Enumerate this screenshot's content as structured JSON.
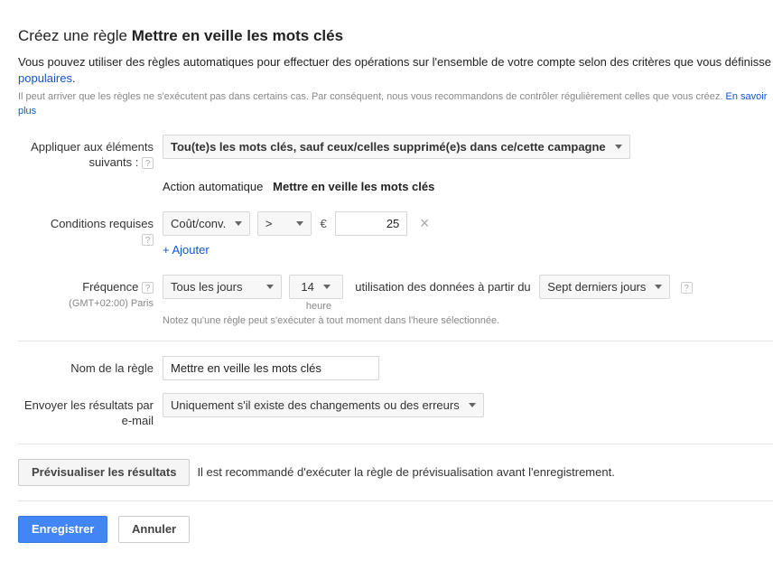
{
  "title_prefix": "Créez une règle",
  "title_bold": "Mettre en veille les mots clés",
  "intro_text": "Vous pouvez utiliser des règles automatiques pour effectuer des opérations sur l'ensemble de votre compte selon des critères que vous définisse",
  "intro_link": "populaires",
  "sub_text": "Il peut arriver que les règles ne s'exécutent pas dans certains cas. Par conséquent, nous vous recommandons de contrôler régulièrement celles que vous créez.",
  "sub_link": "En savoir plus",
  "labels": {
    "apply_to": "Appliquer aux éléments suivants :",
    "conditions": "Conditions requises",
    "frequency": "Fréquence",
    "rule_name": "Nom de la règle",
    "email_results": "Envoyer les résultats par e-mail"
  },
  "apply_to": {
    "selected": "Tou(te)s les mots clés, sauf ceux/celles supprimé(e)s dans ce/cette campagne"
  },
  "auto_action": {
    "label": "Action automatique",
    "value": "Mettre en veille les mots clés"
  },
  "condition": {
    "metric": "Coût/conv.",
    "operator": ">",
    "currency": "€",
    "value": "25",
    "add_label": "+ Ajouter"
  },
  "frequency": {
    "tz": "(GMT+02:00) Paris",
    "every": "Tous les jours",
    "hour": "14",
    "hour_label": "heure",
    "using_label": "utilisation des données à partir du",
    "range": "Sept derniers jours",
    "note": "Notez qu'une règle peut s'exécuter à tout moment dans l'heure sélectionnée."
  },
  "rule_name_value": "Mettre en veille les mots clés",
  "email_selected": "Uniquement s'il existe des changements ou des erreurs",
  "preview": {
    "button": "Prévisualiser les résultats",
    "hint": "Il est recommandé d'exécuter la règle de prévisualisation avant l'enregistrement."
  },
  "buttons": {
    "save": "Enregistrer",
    "cancel": "Annuler"
  }
}
